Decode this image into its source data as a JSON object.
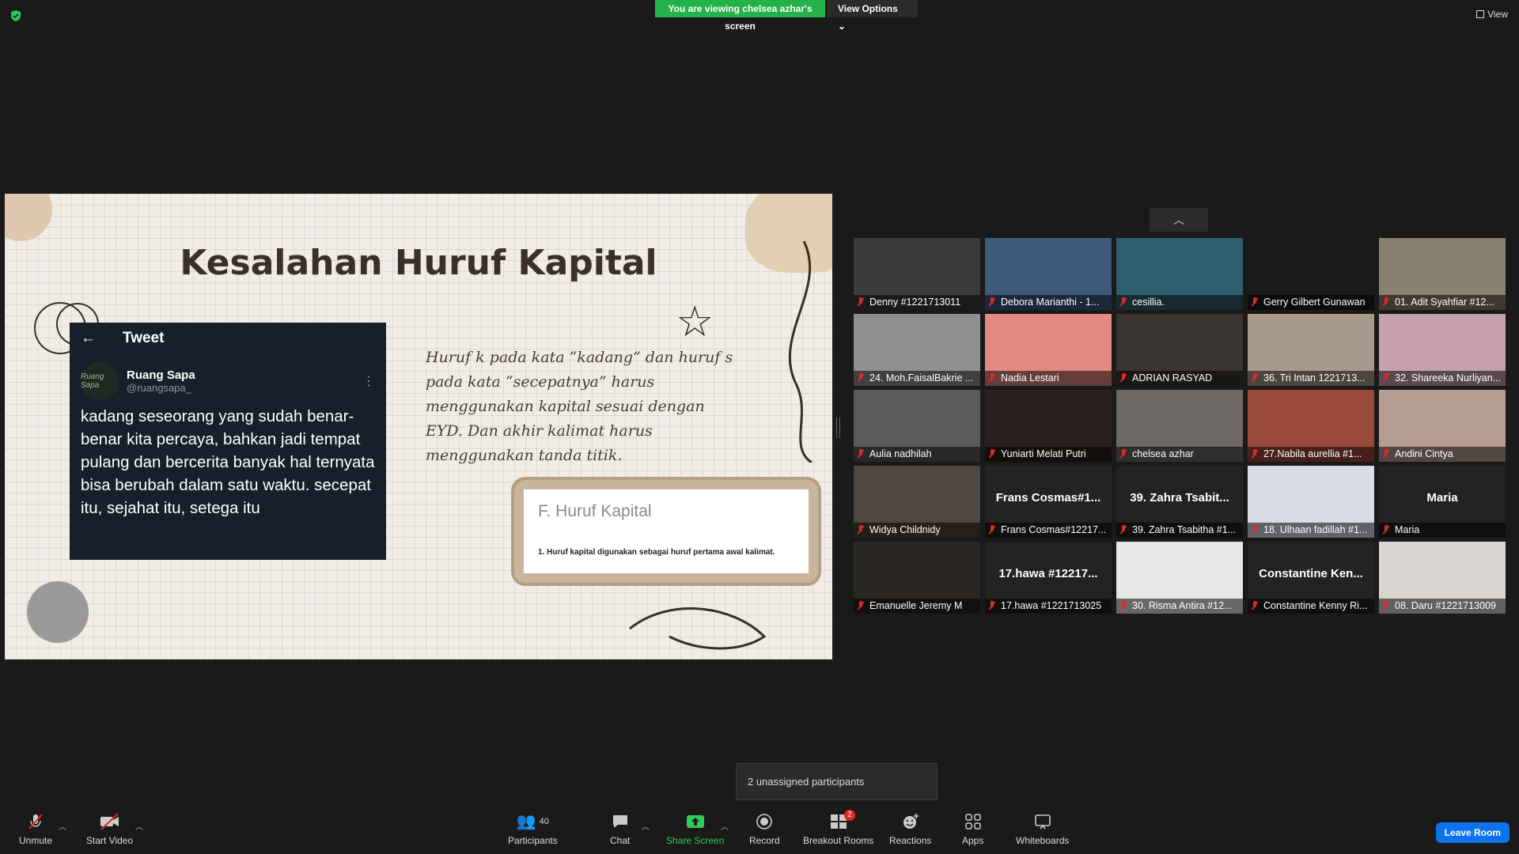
{
  "top": {
    "banner": "You are viewing chelsea azhar's screen",
    "view_options": "View Options",
    "view": "View"
  },
  "slide": {
    "title": "Kesalahan Huruf Kapital",
    "tweet_header": "Tweet",
    "tweet_name": "Ruang Sapa",
    "tweet_handle": "@ruangsapa_",
    "tweet_avatar_text": "Ruang Sapa",
    "tweet_text": "kadang seseorang yang sudah benar-benar kita percaya, bahkan jadi tempat pulang dan bercerita banyak hal ternyata bisa berubah dalam satu waktu. secepat itu, sejahat itu, setega itu",
    "body": "Huruf k pada kata “kadang” dan huruf s pada kata “secepatnya” harus menggunakan kapital sesuai dengan EYD. Dan akhir kalimat harus menggunakan tanda titik.",
    "card_title": "F. Huruf Kapital",
    "card_sub": "1. Huruf kapital digunakan sebagai huruf pertama awal kalimat."
  },
  "participants": [
    {
      "label": "Denny #1221713011",
      "bg": "#3b3a3c"
    },
    {
      "label": "Debora Marianthi - 1...",
      "bg": "#3d5a7a"
    },
    {
      "label": "cesillia.",
      "bg": "#2f5f6e"
    },
    {
      "label": "Gerry Gilbert Gunawan",
      "bg": "#1c1c1c"
    },
    {
      "label": "01. Adit Syahfiar #12...",
      "bg": "#8a8070"
    },
    {
      "label": "24. Moh.FaisalBakrie ...",
      "bg": "#8e8f90"
    },
    {
      "label": "Nadia Lestari",
      "bg": "#e08a82"
    },
    {
      "label": "ADRIAN RASYAD",
      "bg": "#3a3530"
    },
    {
      "label": "36. Tri Intan 1221713...",
      "bg": "#a8998a"
    },
    {
      "label": "32. Shareeka Nurliyan...",
      "bg": "#c7a0b0"
    },
    {
      "label": "Aulia nadhilah",
      "bg": "#5a5a5a"
    },
    {
      "label": "Yuniarti Melati Putri",
      "bg": "#2a1e1c"
    },
    {
      "label": "chelsea azhar",
      "bg": "#6b6866"
    },
    {
      "label": "27.Nabila aurellia #1...",
      "bg": "#9a4a3a"
    },
    {
      "label": "Andini Cintya",
      "bg": "#b59d92"
    },
    {
      "label": "Widya Childnidy",
      "bg": "#4e4640"
    },
    {
      "label": "Frans Cosmas#12217...",
      "big": "Frans Cosmas#1...",
      "bg": "#232323"
    },
    {
      "label": "39. Zahra Tsabitha #1...",
      "big": "39. Zahra Tsabit...",
      "bg": "#232323"
    },
    {
      "label": "18. Ulhaan fadillah #1...",
      "bg": "#d8dce6"
    },
    {
      "label": "Maria",
      "big": "Maria",
      "bg": "#232323"
    },
    {
      "label": "Emanuelle Jeremy M",
      "bg": "#2a2622"
    },
    {
      "label": "17.hawa #1221713025",
      "big": "17.hawa #12217...",
      "bg": "#232323"
    },
    {
      "label": "30. Risma Antira #12...",
      "bg": "#e8e6e4"
    },
    {
      "label": "Constantine Kenny Ri...",
      "big": "Constantine Ken...",
      "bg": "#232323"
    },
    {
      "label": "08. Daru #1221713009",
      "bg": "#d9d5d0"
    }
  ],
  "tooltip": "2 unassigned participants",
  "toolbar": {
    "unmute": "Unmute",
    "start_video": "Start Video",
    "participants": "Participants",
    "participants_count": "40",
    "chat": "Chat",
    "share_screen": "Share Screen",
    "record": "Record",
    "breakout_rooms": "Breakout Rooms",
    "breakout_badge": "2",
    "reactions": "Reactions",
    "apps": "Apps",
    "whiteboards": "Whiteboards",
    "leave_room": "Leave Room"
  }
}
